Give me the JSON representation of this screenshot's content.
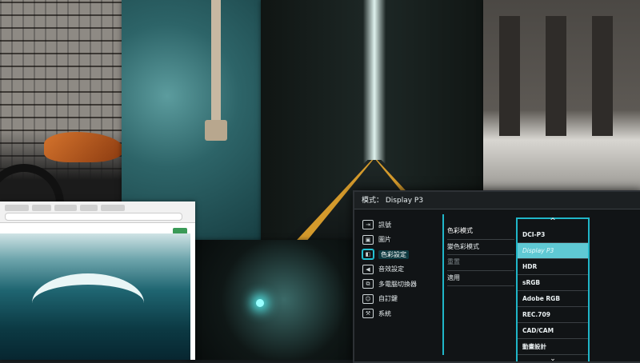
{
  "osd": {
    "header": "模式： Display P3",
    "menu": [
      {
        "icon": "input-icon",
        "label": "訊號"
      },
      {
        "icon": "picture-icon",
        "label": "圖片"
      },
      {
        "icon": "color-icon",
        "label": "色彩設定",
        "active": true
      },
      {
        "icon": "audio-icon",
        "label": "音效設定"
      },
      {
        "icon": "multi-input-icon",
        "label": "多電腦切換器"
      },
      {
        "icon": "user-icon",
        "label": "自訂鍵"
      },
      {
        "icon": "wrench-icon",
        "label": "系統"
      }
    ],
    "submenu": [
      {
        "label": "色彩模式",
        "state": "active"
      },
      {
        "label": "變色彩模式",
        "state": "normal"
      },
      {
        "label": "重置",
        "state": "dim"
      },
      {
        "label": "適用",
        "state": "normal"
      }
    ],
    "dropdown": {
      "up_glyph": "^",
      "down_glyph": "⌄",
      "options": [
        "DCI-P3",
        "Display P3",
        "HDR",
        "sRGB",
        "Adobe RGB",
        "REC.709",
        "CAD/CAM",
        "動畫設計"
      ],
      "selected": "Display P3"
    }
  },
  "colors": {
    "accent": "#20b6c8",
    "selected_bg": "#5fc9d4",
    "panel_bg": "#111416"
  }
}
